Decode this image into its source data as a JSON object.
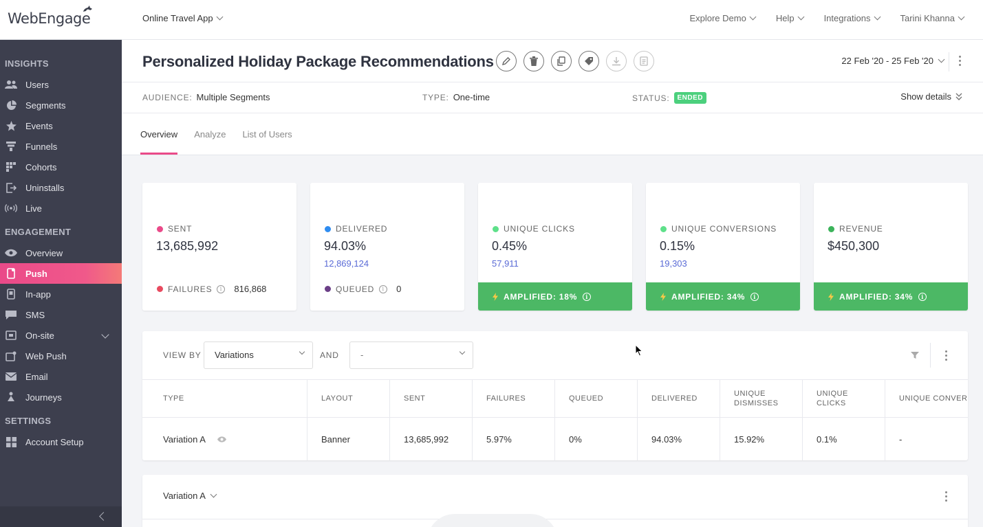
{
  "brand": {
    "logo_text": "WebEngage",
    "accent": "#ea4a89",
    "success": "#4cb865"
  },
  "topbar": {
    "project": "Online Travel App",
    "nav": [
      "Explore Demo",
      "Help",
      "Integrations",
      "Tarini Khanna"
    ]
  },
  "sidebar": {
    "sections": [
      {
        "title": "INSIGHTS",
        "items": [
          {
            "label": "Users",
            "icon": "users-icon"
          },
          {
            "label": "Segments",
            "icon": "pie-icon"
          },
          {
            "label": "Events",
            "icon": "star-icon"
          },
          {
            "label": "Funnels",
            "icon": "funnel-icon"
          },
          {
            "label": "Cohorts",
            "icon": "grid-icon"
          },
          {
            "label": "Uninstalls",
            "icon": "exit-icon"
          },
          {
            "label": "Live",
            "icon": "broadcast-icon"
          }
        ]
      },
      {
        "title": "ENGAGEMENT",
        "items": [
          {
            "label": "Overview",
            "icon": "eye-icon"
          },
          {
            "label": "Push",
            "icon": "phone-icon",
            "active": true
          },
          {
            "label": "In-app",
            "icon": "phone-icon"
          },
          {
            "label": "SMS",
            "icon": "chat-icon"
          },
          {
            "label": "On-site",
            "icon": "window-icon",
            "expandable": true
          },
          {
            "label": "Web Push",
            "icon": "browser-icon"
          },
          {
            "label": "Email",
            "icon": "mail-icon"
          },
          {
            "label": "Journeys",
            "icon": "journey-icon"
          }
        ]
      },
      {
        "title": "SETTINGS",
        "items": [
          {
            "label": "Account Setup",
            "icon": "grid-icon"
          }
        ]
      }
    ]
  },
  "campaign": {
    "title": "Personalized Holiday Package Recommendations",
    "date_range": "22 Feb '20 - 25 Feb '20",
    "audience_label": "AUDIENCE:",
    "audience": "Multiple Segments",
    "type_label": "TYPE:",
    "type": "One-time",
    "status_label": "STATUS:",
    "status": "ENDED",
    "show_details": "Show details"
  },
  "tabs": [
    "Overview",
    "Analyze",
    "List of Users"
  ],
  "stats": [
    {
      "label": "SENT",
      "color": "#ea4a89",
      "value": "13,685,992",
      "sub": "",
      "foot_label": "FAILURES",
      "foot_color": "#e84a5f",
      "foot_value": "816,868",
      "amplified": ""
    },
    {
      "label": "DELIVERED",
      "color": "#2f8cf0",
      "value": "94.03%",
      "sub": "12,869,124",
      "foot_label": "QUEUED",
      "foot_color": "#6b3f87",
      "foot_value": "0",
      "amplified": ""
    },
    {
      "label": "UNIQUE CLICKS",
      "color": "#5ee08a",
      "value": "0.45%",
      "sub": "57,911",
      "amplified": "AMPLIFIED: 18%"
    },
    {
      "label": "UNIQUE CONVERSIONS",
      "color": "#5ee08a",
      "value": "0.15%",
      "sub": "19,303",
      "amplified": "AMPLIFIED: 34%"
    },
    {
      "label": "REVENUE",
      "color": "#3bb35a",
      "value": "$450,300",
      "sub": "",
      "amplified": "AMPLIFIED: 34%"
    }
  ],
  "table": {
    "view_by_label": "VIEW BY",
    "view_by_value": "Variations",
    "and_label": "AND",
    "and_value": "-",
    "columns": [
      "TYPE",
      "LAYOUT",
      "SENT",
      "FAILURES",
      "QUEUED",
      "DELIVERED",
      "UNIQUE DISMISSES",
      "UNIQUE CLICKS",
      "UNIQUE CONVERS"
    ],
    "rows": [
      [
        "Variation A",
        "Banner",
        "13,685,992",
        "5.97%",
        "0%",
        "94.03%",
        "15.92%",
        "0.1%",
        "-"
      ]
    ]
  },
  "variation_panel": {
    "selected": "Variation A"
  }
}
